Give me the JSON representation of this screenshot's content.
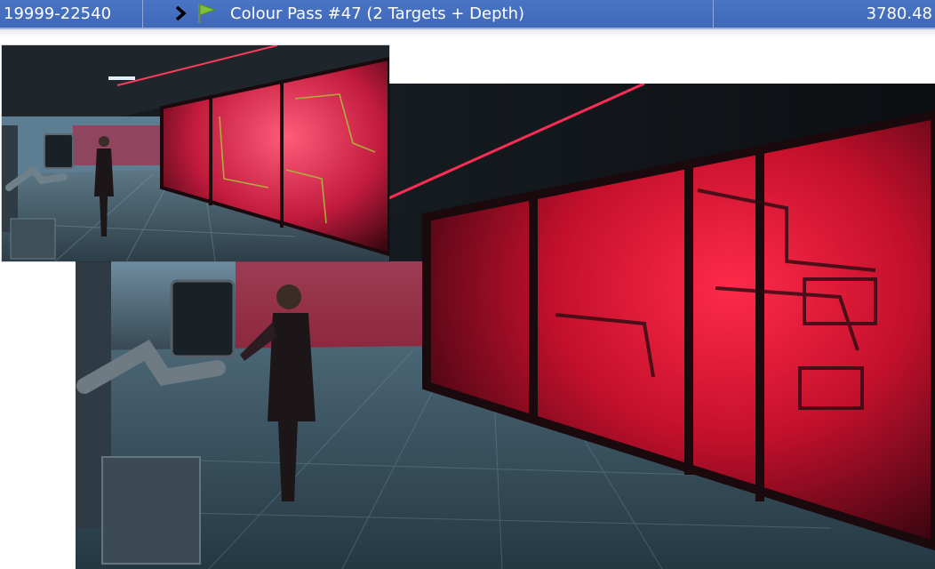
{
  "event_row": {
    "eid_range": "19999-22540",
    "pass_name": "Colour Pass #47 (2 Targets + Depth)",
    "duration": "3780.48",
    "expand_icon": "chevron-right-icon",
    "marker_icon": "green-flag-icon",
    "selected": true
  },
  "colors": {
    "selection": "#4570c0",
    "flag": "#7dc23a",
    "scene_red": "#e01a3a",
    "scene_teal": "#5aa3c0"
  },
  "render_targets": [
    {
      "id": "target-0"
    },
    {
      "id": "target-1"
    }
  ]
}
